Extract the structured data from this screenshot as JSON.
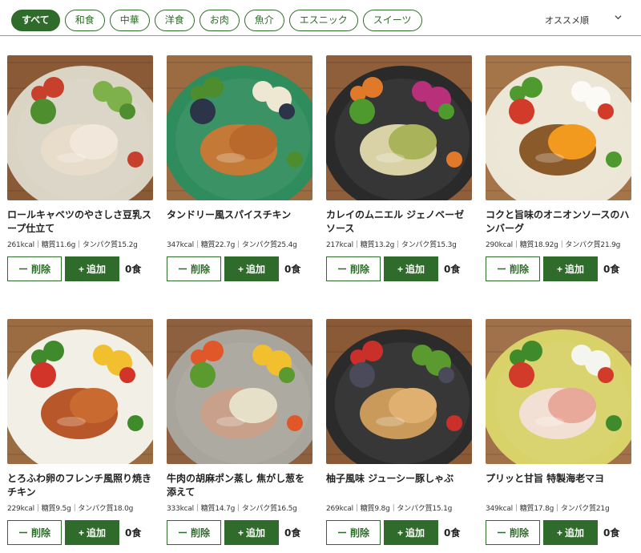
{
  "filters": [
    "すべて",
    "和食",
    "中華",
    "洋食",
    "お肉",
    "魚介",
    "エスニック",
    "スイーツ"
  ],
  "active_filter": "すべて",
  "sort": {
    "label": "オススメ順"
  },
  "buttons": {
    "delete": "削除",
    "add": "追加",
    "delete_symbol": "ー",
    "add_symbol": "+"
  },
  "qty_unit": "食",
  "items": [
    {
      "name": "ロールキャベツのやさしさ豆乳スープ仕立て",
      "nutrition": "261kcal｜糖質11.6g｜タンパク質15.2g",
      "qty": "0",
      "photo": {
        "bg": "#8a5a36",
        "plate": "#d9d4c4",
        "food": [
          "#e8dccb",
          "#f1e8db",
          "#7fb14a",
          "#c7402c",
          "#4f8e2f"
        ]
      }
    },
    {
      "name": "タンドリー風スパイスチキン",
      "nutrition": "347kcal｜糖質22.7g｜タンパク質25.4g",
      "qty": "0",
      "photo": {
        "bg": "#9b6b42",
        "plate": "#2f8c5c",
        "food": [
          "#c47a36",
          "#b8692b",
          "#eee7d2",
          "#4d8d2e",
          "#2b3448"
        ]
      }
    },
    {
      "name": "カレイのムニエル ジェノベーゼソース",
      "nutrition": "217kcal｜糖質13.2g｜タンパク質15.3g",
      "qty": "0",
      "photo": {
        "bg": "#8f5e3a",
        "plate": "#2a2a2a",
        "food": [
          "#d9d2a6",
          "#a8b35a",
          "#b8307a",
          "#e07a2a",
          "#4f9a2f"
        ]
      }
    },
    {
      "name": "コクと旨味のオニオンソースのハンバーグ",
      "nutrition": "290kcal｜糖質18.92g｜タンパク質21.9g",
      "qty": "0",
      "photo": {
        "bg": "#a5754a",
        "plate": "#ece6d6",
        "food": [
          "#8a5a2a",
          "#f29a1e",
          "#fbfaf4",
          "#4f9a2f",
          "#d23a2a"
        ]
      }
    },
    {
      "name": "とろふわ卵のフレンチ風照り焼きチキン",
      "nutrition": "229kcal｜糖質9.5g｜タンパク質18.0g",
      "qty": "0",
      "photo": {
        "bg": "#9b6b42",
        "plate": "#f2efe6",
        "food": [
          "#b8582a",
          "#c96a30",
          "#f2c02e",
          "#3f8a2a",
          "#d2342a"
        ]
      }
    },
    {
      "name": "牛肉の胡麻ポン蒸し 焦がし葱を添えて",
      "nutrition": "333kcal｜糖質14.7g｜タンパク質16.5g",
      "qty": "0",
      "photo": {
        "bg": "#8f6040",
        "plate": "#a8a59c",
        "food": [
          "#c9a08a",
          "#e6e0c8",
          "#f2c02e",
          "#e0572a",
          "#5a9a2f"
        ]
      }
    },
    {
      "name": "柚子風味 ジューシー豚しゃぶ",
      "nutrition": "269kcal｜糖質9.8g｜タンパク質15.1g",
      "qty": "0",
      "photo": {
        "bg": "#8a5a36",
        "plate": "#2b2b2b",
        "food": [
          "#c99a5a",
          "#e0b070",
          "#5a9a2f",
          "#c9302a",
          "#4a4a5a"
        ]
      }
    },
    {
      "name": "プリッと甘旨 特製海老マヨ",
      "nutrition": "349kcal｜糖質17.8g｜タンパク質21g",
      "qty": "0",
      "photo": {
        "bg": "#a0714a",
        "plate": "#d8d268",
        "food": [
          "#f2e0d4",
          "#e8a89a",
          "#f5f5f0",
          "#3f8a2a",
          "#d23a2a"
        ]
      }
    }
  ]
}
